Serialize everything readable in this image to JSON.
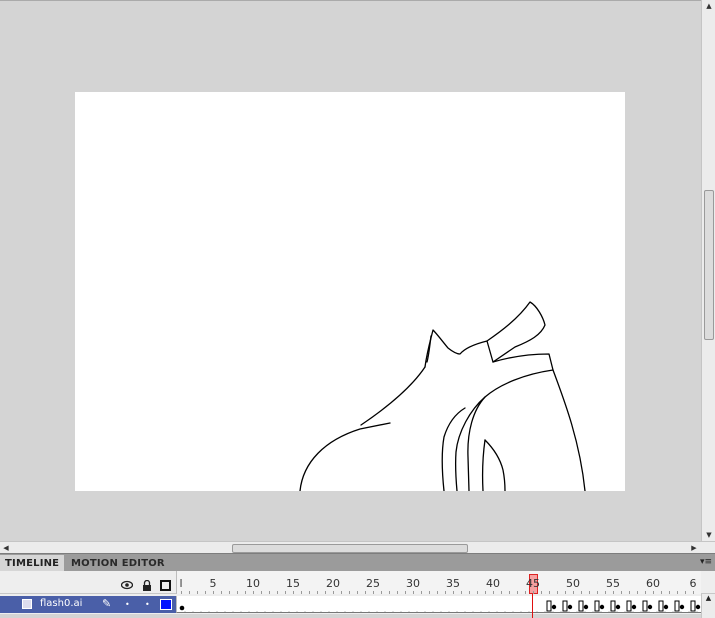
{
  "panel": {
    "tabs": [
      "TIMELINE",
      "MOTION EDITOR"
    ],
    "active_tab": "TIMELINE",
    "menu_icon": "panel-menu-icon"
  },
  "timeline": {
    "ruler_labels": [
      "l",
      "5",
      "10",
      "15",
      "20",
      "25",
      "30",
      "35",
      "40",
      "45",
      "50",
      "55",
      "60",
      "6"
    ],
    "current_frame": 45,
    "header_icons": [
      "eye-icon",
      "lock-icon",
      "outline-icon"
    ],
    "layers": [
      {
        "name": "flash0.ai",
        "color": "#0010ff",
        "icon": "layer-icon",
        "editing_icon": "pencil-icon"
      }
    ]
  },
  "colors": {
    "pasteboard": "#d4d4d4",
    "stage": "#ffffff",
    "layer_selected": "#4a5fa8",
    "playhead": "#e01010"
  },
  "icons": {
    "scroll_up": "▲",
    "scroll_down": "▼",
    "scroll_left": "◀",
    "scroll_right": "▶",
    "eye": "👁",
    "lock": "🔒",
    "pencil": "✎",
    "dot": "•",
    "menu": "▾≡"
  }
}
